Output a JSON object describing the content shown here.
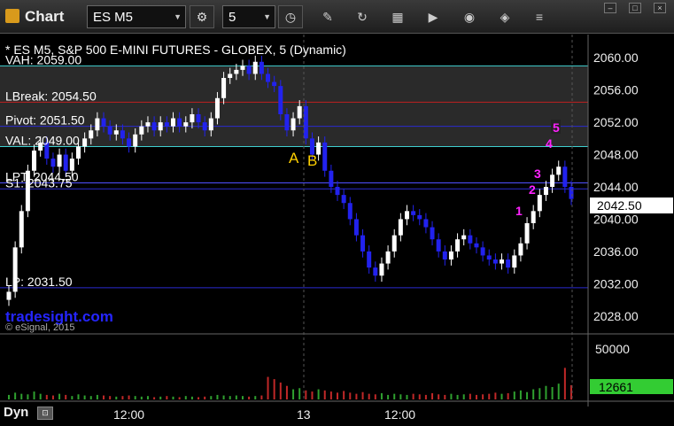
{
  "toolbar": {
    "title": "Chart",
    "symbol": "ES M5",
    "interval": "5"
  },
  "chart_header": "* ES M5, S&P 500 E-MINI FUTURES - GLOBEX, 5 (Dynamic)",
  "watermark": "tradesight.com",
  "copyright": "© eSignal, 2015",
  "levels": [
    {
      "label": "VAH: 2059.00",
      "price": 2059.0,
      "color": "#3fd0d0"
    },
    {
      "label": "LBreak: 2054.50",
      "price": 2054.5,
      "color": "#c02020"
    },
    {
      "label": "Pivot: 2051.50",
      "price": 2051.5,
      "color": "#2a2ad0"
    },
    {
      "label": "VAL: 2049.00",
      "price": 2049.0,
      "color": "#3fd0d0"
    },
    {
      "label": "LPT: 2044.50",
      "price": 2044.5,
      "color": "#5050ff"
    },
    {
      "label": "S1: 2043.75",
      "price": 2043.75,
      "color": "#2a2ad0"
    },
    {
      "label": "LP: 2031.50",
      "price": 2031.5,
      "color": "#2a2ad0"
    }
  ],
  "price_axis": {
    "ticks": [
      "2060.00",
      "2056.00",
      "2052.00",
      "2048.00",
      "2044.00",
      "2040.00",
      "2036.00",
      "2032.00",
      "2028.00"
    ],
    "current_price": "2042.50"
  },
  "volume_axis": {
    "tick": "50000",
    "current_volume": "12661"
  },
  "time_axis": [
    "12:00",
    "13",
    "12:00"
  ],
  "annotations": {
    "a": "A",
    "b": "B",
    "counts": [
      "1",
      "2",
      "3",
      "4",
      "5"
    ]
  },
  "bottom_label": "Dyn",
  "colors": {
    "up": "#ffffff",
    "down": "#2222ee",
    "accent": "#ff22ff",
    "volume_badge": "#33cc33"
  },
  "chart_data": {
    "type": "candlestick",
    "y_range": [
      2026,
      2062
    ],
    "closes": [
      2031.0,
      2036.5,
      2041.0,
      2046.0,
      2048.5,
      2049.5,
      2047.5,
      2046.5,
      2048.0,
      2046.0,
      2047.5,
      2049.0,
      2050.0,
      2051.0,
      2052.5,
      2051.5,
      2050.5,
      2051.0,
      2050.0,
      2049.0,
      2050.5,
      2051.5,
      2052.0,
      2051.0,
      2052.0,
      2051.5,
      2052.5,
      2051.5,
      2052.0,
      2053.0,
      2052.0,
      2051.0,
      2052.5,
      2055.0,
      2057.5,
      2058.0,
      2058.5,
      2059.0,
      2058.0,
      2059.5,
      2058.0,
      2057.0,
      2056.5,
      2053.0,
      2051.0,
      2052.5,
      2054.0,
      2050.0,
      2048.0,
      2049.5,
      2046.0,
      2044.0,
      2043.0,
      2042.0,
      2040.0,
      2038.0,
      2036.0,
      2034.0,
      2033.0,
      2034.5,
      2036.0,
      2038.0,
      2040.0,
      2041.0,
      2040.5,
      2040.0,
      2039.0,
      2037.5,
      2036.0,
      2035.0,
      2036.0,
      2037.5,
      2038.0,
      2037.0,
      2036.5,
      2035.5,
      2035.0,
      2034.5,
      2035.0,
      2034.0,
      2035.5,
      2037.0,
      2039.5,
      2041.0,
      2043.0,
      2044.0,
      2045.5,
      2046.5,
      2044.0,
      2042.5
    ],
    "volumes": [
      4000,
      6000,
      5000,
      4500,
      7000,
      5000,
      4000,
      3500,
      5000,
      4000,
      3000,
      4500,
      3500,
      3000,
      4000,
      3500,
      3000,
      2500,
      3000,
      3500,
      3000,
      2500,
      3000,
      2000,
      2500,
      3000,
      2500,
      2000,
      3000,
      2500,
      2000,
      2500,
      3000,
      4000,
      3500,
      3000,
      3500,
      3000,
      2500,
      3000,
      3500,
      20000,
      18000,
      15000,
      12000,
      9000,
      10000,
      8000,
      7000,
      9000,
      8000,
      7000,
      6000,
      7500,
      6000,
      5000,
      6500,
      5000,
      4500,
      5500,
      4000,
      5000,
      4500,
      4000,
      5000,
      4500,
      4000,
      5500,
      4500,
      4000,
      5000,
      4000,
      4500,
      5000,
      4000,
      4500,
      5000,
      6000,
      5000,
      5500,
      7000,
      8000,
      6500,
      9000,
      10000,
      12000,
      11000,
      14000,
      28000,
      12661
    ]
  }
}
